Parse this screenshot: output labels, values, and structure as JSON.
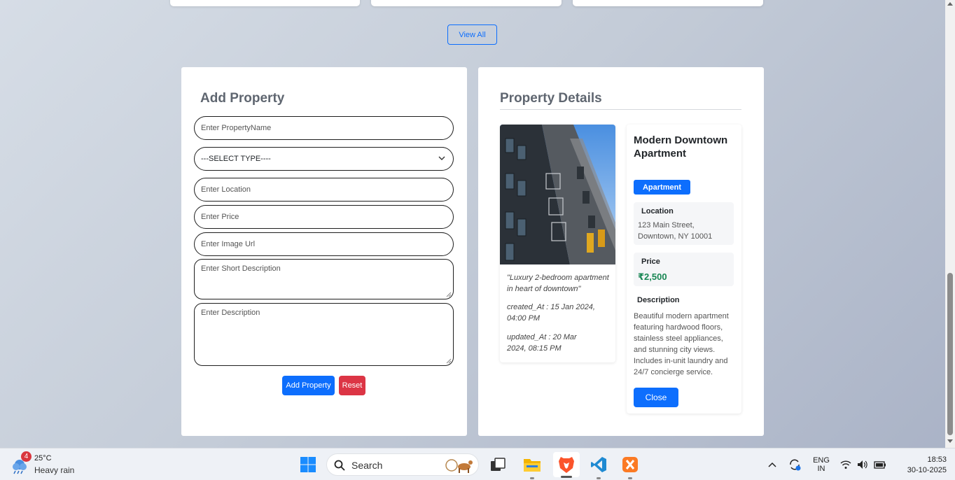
{
  "view_all_label": "View All",
  "add_form": {
    "title": "Add Property",
    "property_name_placeholder": "Enter PropertyName",
    "type_select_value": "---SELECT TYPE----",
    "location_placeholder": "Enter Location",
    "price_placeholder": "Enter Price",
    "image_url_placeholder": "Enter Image Url",
    "short_desc_placeholder": "Enter Short Description",
    "desc_placeholder": "Enter Description",
    "add_button": "Add Property",
    "reset_button": "Reset"
  },
  "details": {
    "title": "Property Details",
    "short_description": "\"Luxury 2-bedroom apartment in heart of downtown\"",
    "created_at": "created_At : 15 Jan 2024, 04:00 PM",
    "updated_at": "updated_At : 20 Mar 2024, 08:15 PM",
    "name": "Modern Downtown Apartment",
    "type_badge": "Apartment",
    "location_label": "Location",
    "location_value": "123 Main Street, Downtown, NY 10001",
    "price_label": "Price",
    "price_value": "₹2,500",
    "description_label": "Description",
    "description_value": "Beautiful modern apartment featuring hardwood floors, stainless steel appliances, and stunning city views. Includes in-unit laundry and 24/7 concierge service.",
    "close_button": "Close"
  },
  "taskbar": {
    "weather_badge": "4",
    "temperature": "25°C",
    "condition": "Heavy rain",
    "search_label": "Search",
    "lang_top": "ENG",
    "lang_bottom": "IN",
    "time": "18:53",
    "date": "30-10-2025"
  },
  "colors": {
    "primary": "#0d6efd",
    "danger": "#dc3545",
    "price_green": "#198754"
  }
}
